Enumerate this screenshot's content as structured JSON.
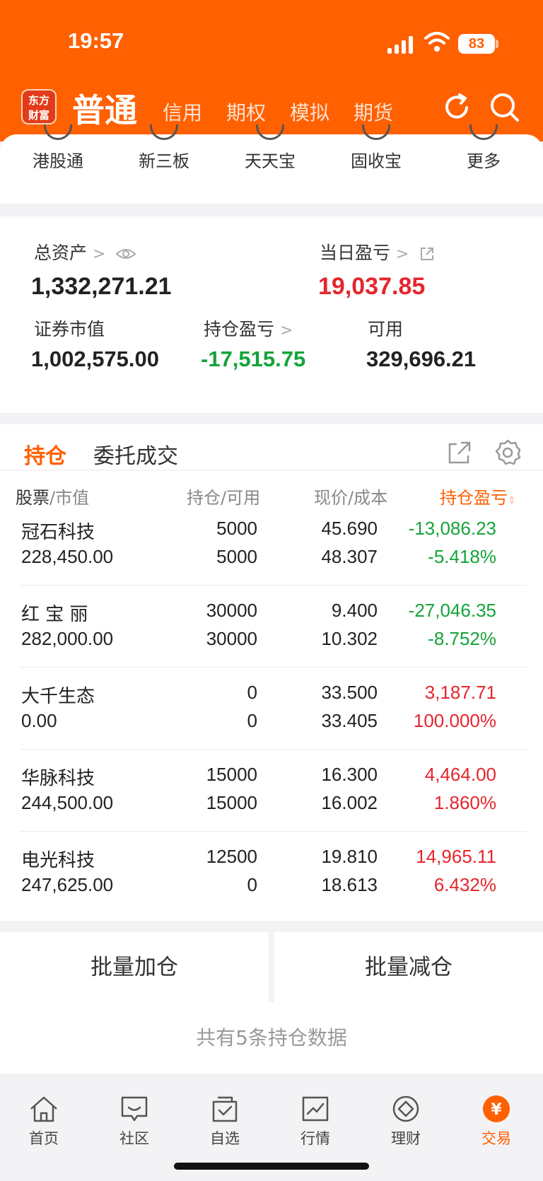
{
  "status_bar": {
    "time": "19:57",
    "battery": "83"
  },
  "header": {
    "logo_line1": "东方",
    "logo_line2": "财富",
    "main_tab": "普通",
    "tabs": [
      "信用",
      "期权",
      "模拟",
      "期货"
    ]
  },
  "shortcuts": [
    "港股通",
    "新三板",
    "天天宝",
    "固收宝",
    "更多"
  ],
  "assets": {
    "total_label": "总资产",
    "total_value": "1,332,271.21",
    "daily_label": "当日盈亏",
    "daily_value": "19,037.85",
    "market_label": "证券市值",
    "market_value": "1,002,575.00",
    "holding_pl_label": "持仓盈亏",
    "holding_pl_value": "-17,515.75",
    "available_label": "可用",
    "available_value": "329,696.21"
  },
  "holdings": {
    "tab_active": "持仓",
    "tab_inactive": "委托成交",
    "columns": {
      "stock": "股票",
      "mv": "市值",
      "pos": "持仓",
      "avail": "可用",
      "price": "现价",
      "cost": "成本",
      "pl": "持仓盈亏"
    },
    "rows": [
      {
        "name": "冠石科技",
        "market_value": "228,450.00",
        "position": "5000",
        "available": "5000",
        "price": "45.690",
        "cost": "48.307",
        "pl": "-13,086.23",
        "pl_pct": "-5.418%",
        "trend": "down"
      },
      {
        "name": "红 宝 丽",
        "market_value": "282,000.00",
        "position": "30000",
        "available": "30000",
        "price": "9.400",
        "cost": "10.302",
        "pl": "-27,046.35",
        "pl_pct": "-8.752%",
        "trend": "down"
      },
      {
        "name": "大千生态",
        "market_value": "0.00",
        "position": "0",
        "available": "0",
        "price": "33.500",
        "cost": "33.405",
        "pl": "3,187.71",
        "pl_pct": "100.000%",
        "trend": "up"
      },
      {
        "name": "华脉科技",
        "market_value": "244,500.00",
        "position": "15000",
        "available": "15000",
        "price": "16.300",
        "cost": "16.002",
        "pl": "4,464.00",
        "pl_pct": "1.860%",
        "trend": "up"
      },
      {
        "name": "电光科技",
        "market_value": "247,625.00",
        "position": "12500",
        "available": "0",
        "price": "19.810",
        "cost": "18.613",
        "pl": "14,965.11",
        "pl_pct": "6.432%",
        "trend": "up"
      }
    ]
  },
  "actions": {
    "batch_add": "批量加仓",
    "batch_reduce": "批量减仓"
  },
  "summary": "共有5条持仓数据",
  "bottom_nav": [
    {
      "label": "首页",
      "icon": "home-icon"
    },
    {
      "label": "社区",
      "icon": "community-icon"
    },
    {
      "label": "自选",
      "icon": "watchlist-icon"
    },
    {
      "label": "行情",
      "icon": "market-icon"
    },
    {
      "label": "理财",
      "icon": "wealth-icon"
    },
    {
      "label": "交易",
      "icon": "trade-icon"
    }
  ],
  "colors": {
    "brand": "#ff6000",
    "up": "#e4262d",
    "down": "#15a33a"
  }
}
